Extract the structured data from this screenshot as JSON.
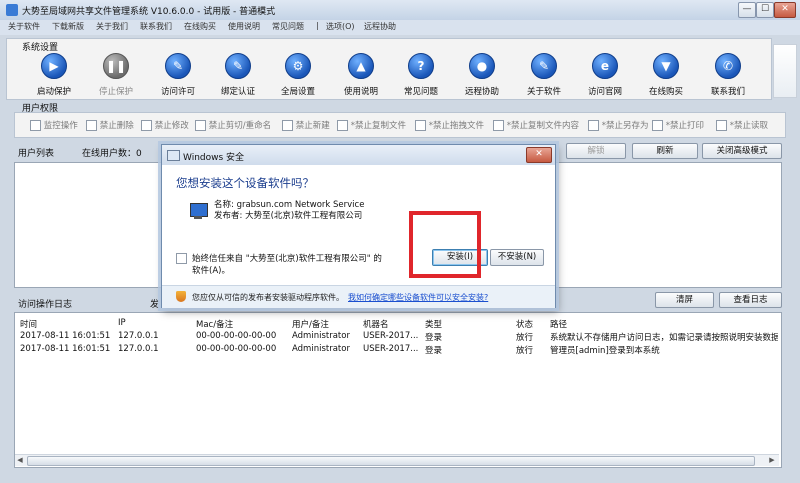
{
  "window": {
    "title": "大势至局域网共享文件管理系统 V10.6.0.0 - 试用版 - 普通模式",
    "min": "—",
    "max": "☐",
    "close": "✕"
  },
  "menu": [
    "关于软件",
    "下载新版",
    "关于我们",
    "联系我们",
    "在线购买",
    "使用说明",
    "常见问题",
    "|",
    "选项(O)",
    "远程协助"
  ],
  "system_settings": {
    "label": "系统设置",
    "tools": [
      {
        "label": "启动保护",
        "icon": "play-icon",
        "glyph": "▶"
      },
      {
        "label": "停止保护",
        "icon": "pause-icon",
        "glyph": "❚❚",
        "disabled": true
      },
      {
        "label": "访问许可",
        "icon": "pen-icon",
        "glyph": "✎"
      },
      {
        "label": "绑定认证",
        "icon": "pen-icon",
        "glyph": "✎"
      },
      {
        "label": "全局设置",
        "icon": "gear-icon",
        "glyph": "⚙"
      },
      {
        "label": "使用说明",
        "icon": "graduation-cap-icon",
        "glyph": "▲"
      },
      {
        "label": "常见问题",
        "icon": "question-icon",
        "glyph": "?"
      },
      {
        "label": "远程协助",
        "icon": "remote-help-icon",
        "glyph": "●"
      },
      {
        "label": "关于软件",
        "icon": "pen-icon",
        "glyph": "✎"
      },
      {
        "label": "访问官网",
        "icon": "ie-icon",
        "glyph": "e"
      },
      {
        "label": "在线购买",
        "icon": "cart-icon",
        "glyph": "▼"
      },
      {
        "label": "联系我们",
        "icon": "contact-icon",
        "glyph": "✆"
      }
    ]
  },
  "user_permissions": {
    "label": "用户权限",
    "items": [
      "监控操作",
      "禁止删除",
      "禁止修改",
      "禁止剪切/重命名",
      "禁止新建",
      "*禁止复制文件",
      "*禁止拖拽文件",
      "*禁止复制文件内容",
      "*禁止另存为",
      "*禁止打印",
      "*禁止读取"
    ]
  },
  "user_list": {
    "label": "用户列表",
    "online_label": "在线用户数：0",
    "buttons": {
      "unlock": "解锁",
      "refresh": "刷新",
      "close_advanced": "关闭高级模式"
    }
  },
  "log": {
    "label": "访问操作日志",
    "send_label": "发",
    "buttons": {
      "clear": "清屏",
      "view_log": "查看日志"
    },
    "columns": [
      "时间",
      "IP",
      "Mac/备注",
      "用户/备注",
      "机器名",
      "类型",
      "状态",
      "路径"
    ],
    "rows": [
      [
        "2017-08-11 16:01:51",
        "127.0.0.1",
        "00-00-00-00-00-00",
        "Administrator",
        "USER-2017...",
        "登录",
        "放行",
        "系统默认不存储用户访问日志，如需记录请按照说明安装数据库"
      ],
      [
        "2017-08-11 16:01:51",
        "127.0.0.1",
        "00-00-00-00-00-00",
        "Administrator",
        "USER-2017...",
        "登录",
        "放行",
        "管理员[admin]登录到本系统"
      ]
    ]
  },
  "dialog": {
    "title": "Windows 安全",
    "close": "✕",
    "question": "您想安装这个设备软件吗？",
    "name_line": "名称: grabsun.com Network Service",
    "publisher_line": "发布者: 大势至(北京)软件工程有限公司",
    "always_trust_1": "始终信任来自 \"大势至(北京)软件工程有限公司\" 的",
    "always_trust_2": "软件(A)。",
    "install": "安装(I)",
    "dont_install": "不安装(N)",
    "footer_text": "您应仅从可信的发布者安装驱动程序软件。",
    "footer_link": "我如何确定哪些设备软件可以安全安装?"
  },
  "colors": {
    "highlight": "#e0262b",
    "heading": "#1d3f8f",
    "link": "#1a4fcf"
  }
}
